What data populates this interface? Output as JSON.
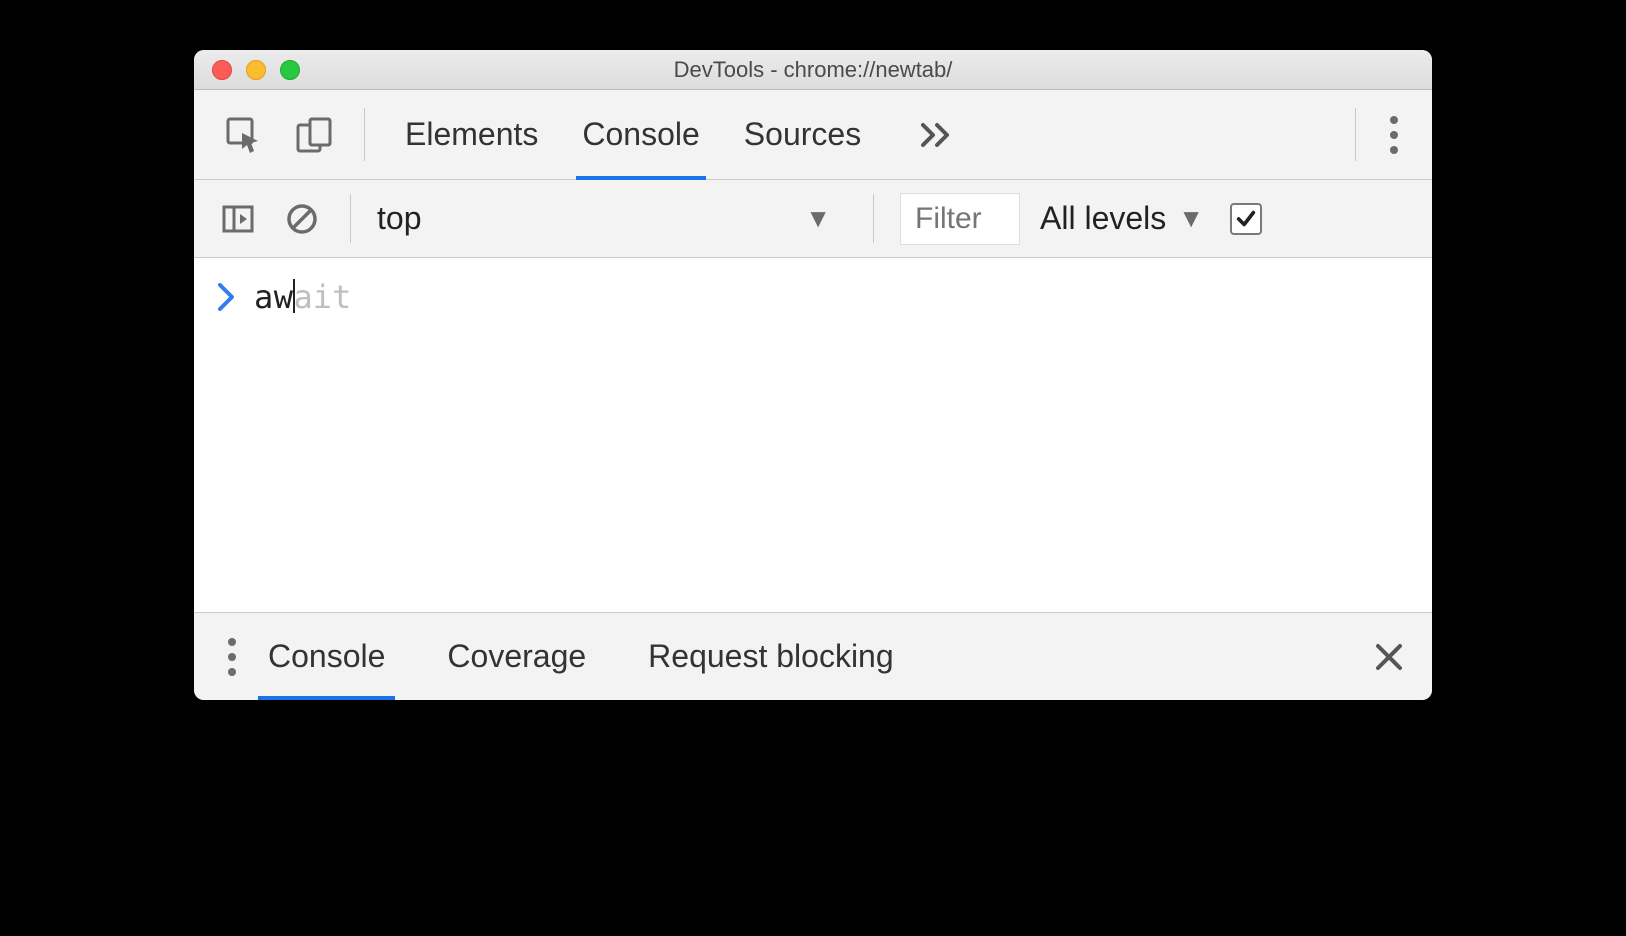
{
  "window": {
    "title": "DevTools - chrome://newtab/"
  },
  "tabs": {
    "elements": "Elements",
    "console": "Console",
    "sources": "Sources"
  },
  "consoleToolbar": {
    "context": "top",
    "filterPlaceholder": "Filter",
    "levels": "All levels"
  },
  "consoleInput": {
    "typed": "aw",
    "suggestion": "ait"
  },
  "drawer": {
    "console": "Console",
    "coverage": "Coverage",
    "requestBlocking": "Request blocking"
  }
}
